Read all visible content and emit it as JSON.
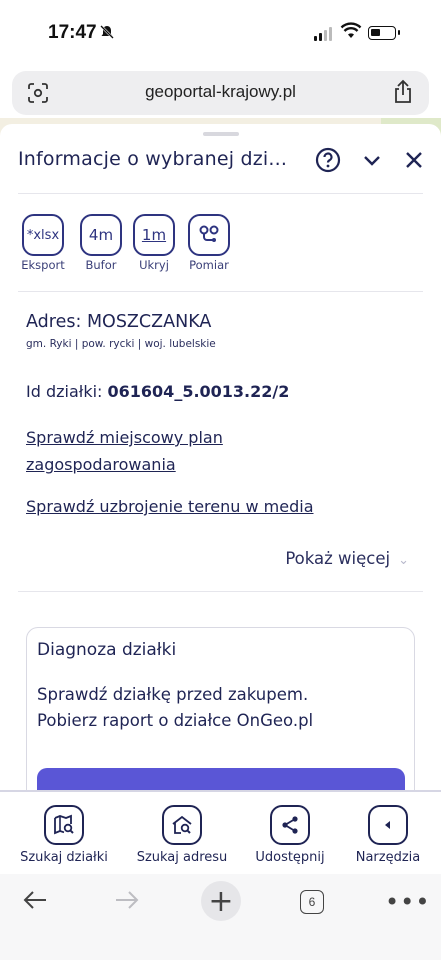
{
  "status": {
    "time": "17:47"
  },
  "browser": {
    "url": "geoportal-krajowy.pl",
    "tab_count": "6"
  },
  "sheet": {
    "title": "Informacje o wybranej dzi...",
    "tools": [
      {
        "icon_text": "*xlsx",
        "label": "Eksport"
      },
      {
        "icon_text": "4m",
        "label": "Bufor"
      },
      {
        "icon_text": "1m",
        "label": "Ukryj"
      },
      {
        "icon_text": "",
        "label": "Pomiar"
      }
    ],
    "address_label": "Adres:",
    "address_value": "MOSZCZANKA",
    "address_sub": "gm. Ryki | pow. rycki | woj. lubelskie",
    "parcel_label": "Id działki:",
    "parcel_id": "061604_5.0013.22/2",
    "link_plan_line1": "Sprawdź miejscowy plan",
    "link_plan_line2": "zagospodarowania",
    "link_media": "Sprawdź uzbrojenie terenu w media",
    "show_more": "Pokaż więcej"
  },
  "card": {
    "title": "Diagnoza działki",
    "text_line1": "Sprawdź działkę przed zakupem.",
    "text_line2": "Pobierz raport o działce OnGeo.pl"
  },
  "bottom_nav": [
    {
      "label": "Szukaj działki"
    },
    {
      "label": "Szukaj adresu"
    },
    {
      "label": "Udostępnij"
    },
    {
      "label": "Narzędzia"
    }
  ],
  "colors": {
    "accent": "#5a56d6",
    "text": "#1f2454"
  }
}
